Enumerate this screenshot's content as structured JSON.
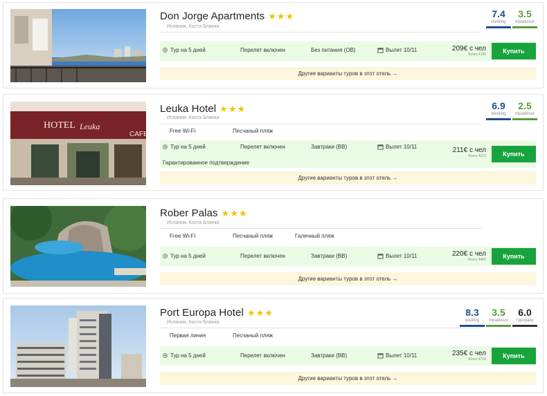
{
  "hotels": [
    {
      "name": "Don Jorge Apartments",
      "stars": 3,
      "location": "Испания, Коста Бланка",
      "ratings": [
        {
          "score": "7.4",
          "source": "booking",
          "kind": "booking"
        },
        {
          "score": "3.5",
          "source": "tripadvisor",
          "kind": "trip"
        }
      ],
      "features": [],
      "offer": {
        "tour": "Тур на 5 дней",
        "flight": "Перелет включен",
        "meals": "Без питания (OB)",
        "departure": "Вылет 10/11",
        "price": "209€ с чел",
        "total": "Всего 419€",
        "note": ""
      },
      "buy_label": "Купить",
      "more_label": "Другие варианты туров в этот отель →"
    },
    {
      "name": "Leuka Hotel",
      "stars": 3,
      "location": "Испания, Коста Бланка",
      "ratings": [
        {
          "score": "6.9",
          "source": "booking",
          "kind": "booking"
        },
        {
          "score": "2.5",
          "source": "tripadvisor",
          "kind": "trip"
        }
      ],
      "features": [
        "Free Wi-Fi",
        "Песчаный пляж"
      ],
      "offer": {
        "tour": "Тур на 5 дней",
        "flight": "Перелет включен",
        "meals": "Завтраки (BB)",
        "departure": "Вылет 10/11",
        "price": "211€ с чел",
        "total": "Всего 421€",
        "note": "Гарантированное подтверждение"
      },
      "buy_label": "Купить",
      "more_label": "Другие варианты туров в этот отель →",
      "photo_sign_1": "HOTEL",
      "photo_sign_2": "Leuka",
      "photo_sign_3": "CAFE"
    },
    {
      "name": "Rober Palas",
      "stars": 3,
      "location": "Испания, Коста Бланка",
      "ratings": [],
      "features": [
        "Free Wi-Fi",
        "Песчаный пляж",
        "Галечный пляж"
      ],
      "offer": {
        "tour": "Тур на 5 дней",
        "flight": "Перелет включен",
        "meals": "Завтраки (BB)",
        "departure": "Вылет 10/11",
        "price": "220€ с чел",
        "total": "Всего 440€",
        "note": ""
      },
      "buy_label": "Купить",
      "more_label": "Другие варианты туров в этот отель →"
    },
    {
      "name": "Port Europa Hotel",
      "stars": 3,
      "location": "Испания, Коста Бланка",
      "ratings": [
        {
          "score": "8.3",
          "source": "booking",
          "kind": "booking"
        },
        {
          "score": "3.5",
          "source": "tripadvisor",
          "kind": "trip"
        },
        {
          "score": "6.0",
          "source": "турпрайс",
          "kind": "top"
        }
      ],
      "features": [
        "Первая линия",
        "Песчаный пляж"
      ],
      "offer": {
        "tour": "Тур на 5 дней",
        "flight": "Перелет включен",
        "meals": "Завтраки (BB)",
        "departure": "Вылет 10/11",
        "price": "235€ с чел",
        "total": "Всего 471€",
        "note": ""
      },
      "buy_label": "Купить",
      "more_label": "Другие варианты туров в этот отель →"
    }
  ],
  "colors": {
    "buy": "#18a33c",
    "offer_bg": "#eafbe4",
    "more_bg": "#fbf6dc",
    "star": "#f2c200",
    "booking": "#1f4e8c",
    "tripadvisor": "#5a9a3a"
  }
}
